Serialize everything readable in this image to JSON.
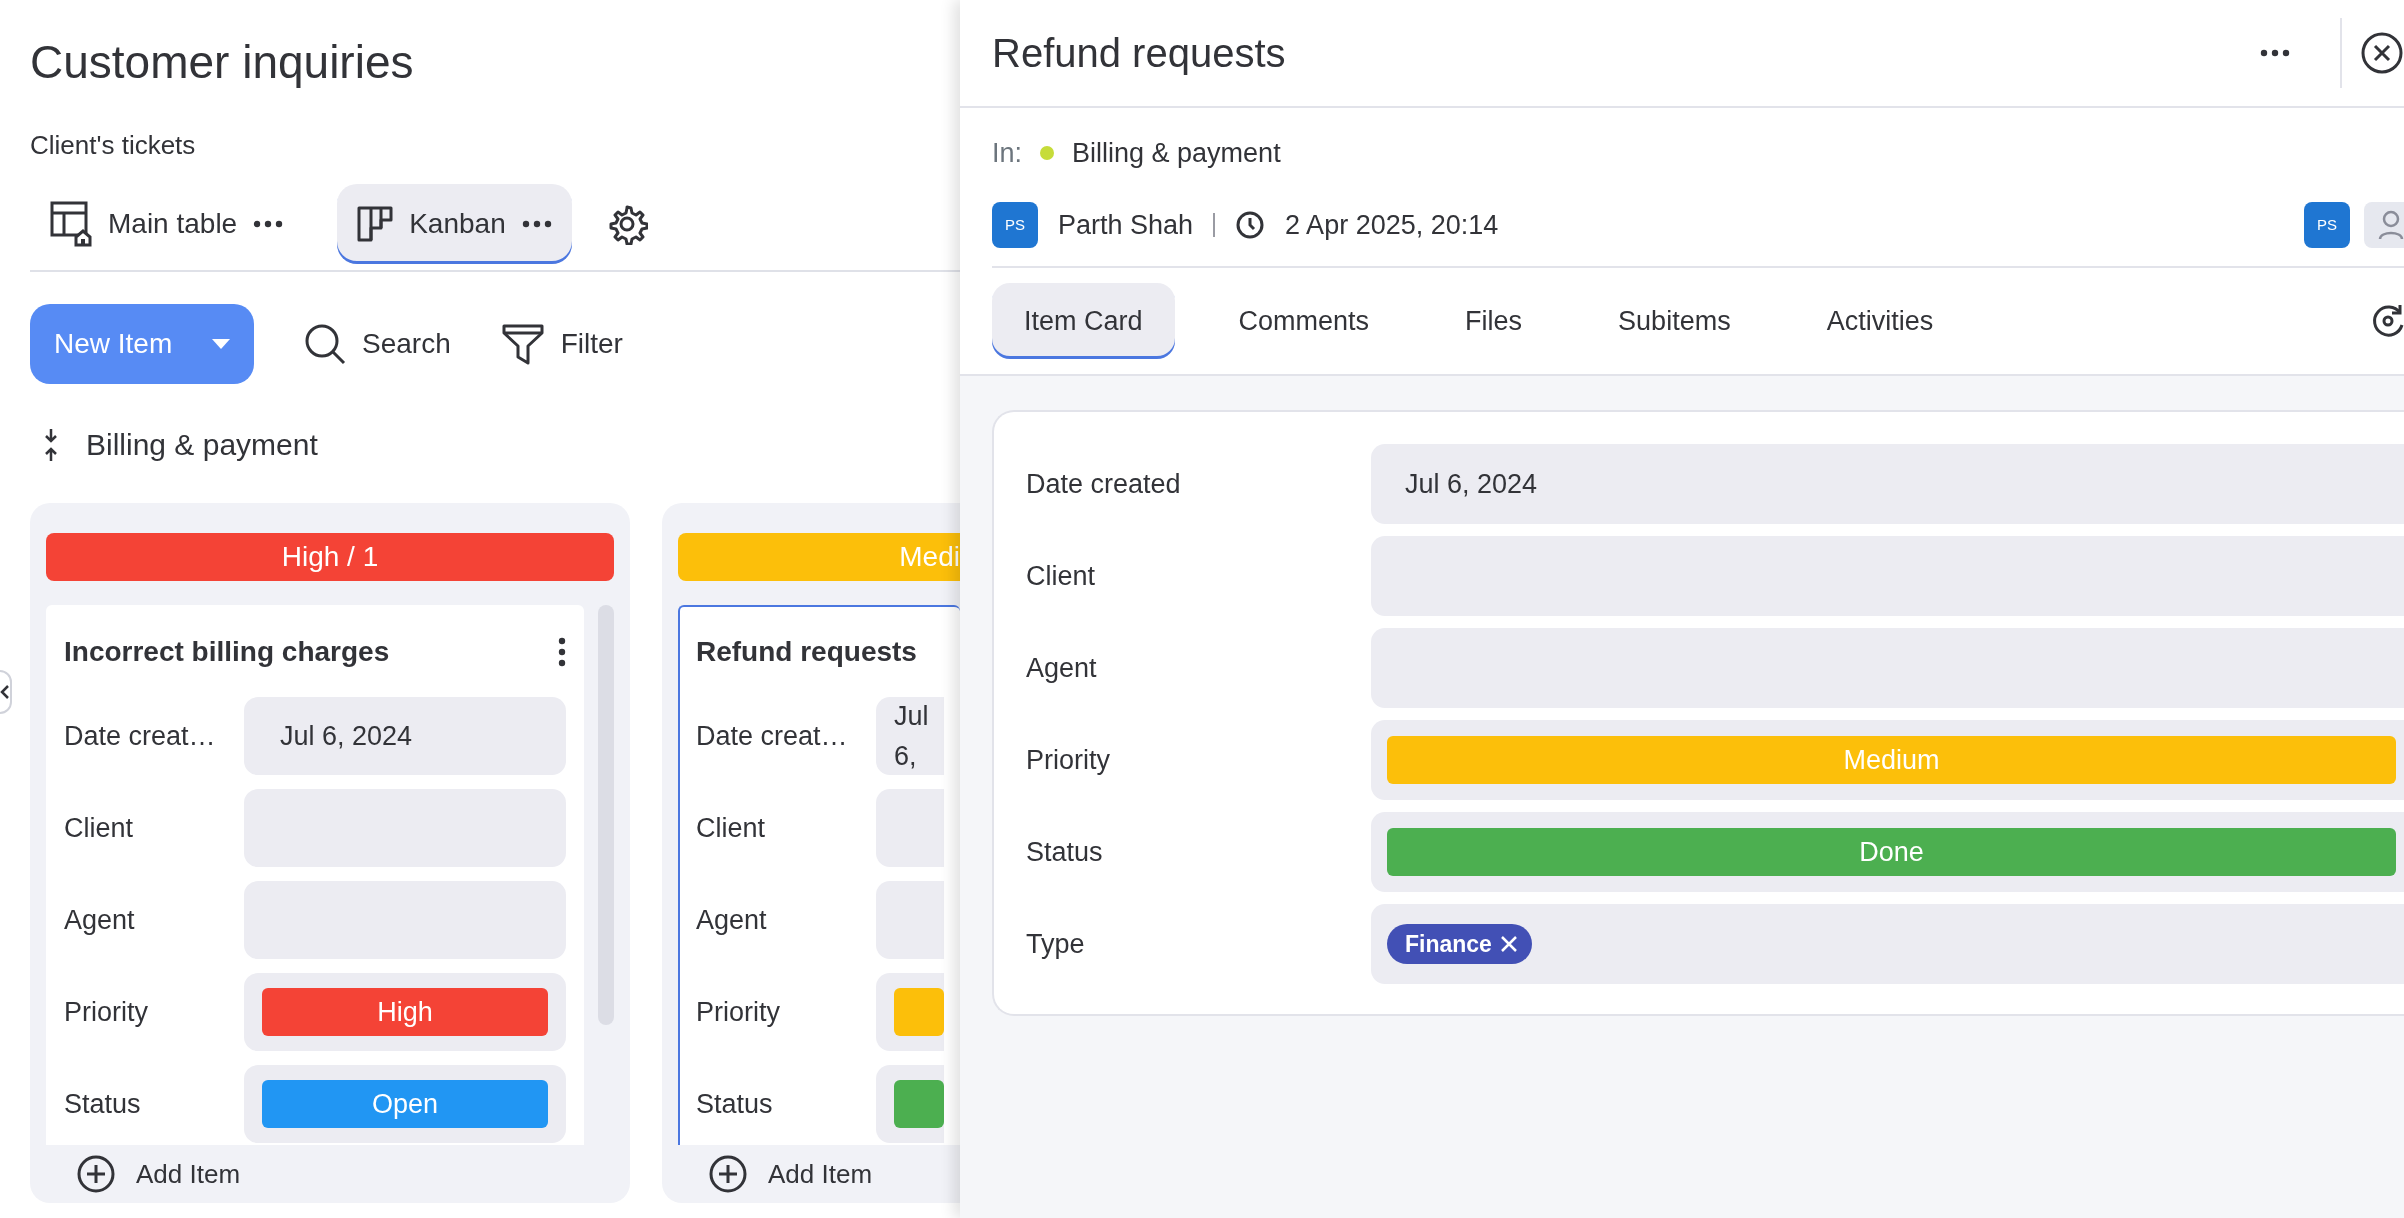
{
  "board": {
    "title": "Customer inquiries",
    "subtitle": "Client's tickets",
    "views": [
      {
        "label": "Main table",
        "kind": "table",
        "selected": false
      },
      {
        "label": "Kanban",
        "kind": "kanban",
        "selected": true
      }
    ],
    "toolbar": {
      "new_item": "New Item",
      "search": "Search",
      "filter": "Filter"
    },
    "group": {
      "title": "Billing & payment"
    },
    "columns": [
      {
        "header": "High / 1",
        "color": "#f44336",
        "add_item": "Add Item",
        "cards": [
          {
            "title": "Incorrect billing charges",
            "selected": false,
            "fields": [
              {
                "label": "Date creat…",
                "kind": "text",
                "value": "Jul 6, 2024"
              },
              {
                "label": "Client",
                "kind": "text"
              },
              {
                "label": "Agent",
                "kind": "text"
              },
              {
                "label": "Priority",
                "kind": "pill",
                "value": "High",
                "color": "#f44336"
              },
              {
                "label": "Status",
                "kind": "pill",
                "value": "Open",
                "color": "#2196f3"
              }
            ]
          }
        ]
      },
      {
        "header": "Medi",
        "color": "#fcbf0a",
        "add_item": "Add Item",
        "cards": [
          {
            "title": "Refund requests",
            "selected": true,
            "fields": [
              {
                "label": "Date creat…",
                "kind": "text",
                "value": "Jul 6,"
              },
              {
                "label": "Client",
                "kind": "text"
              },
              {
                "label": "Agent",
                "kind": "text"
              },
              {
                "label": "Priority",
                "kind": "pill",
                "color": "#fcbf0a"
              },
              {
                "label": "Status",
                "kind": "pill",
                "color": "#4caf50"
              }
            ]
          }
        ]
      }
    ]
  },
  "panel": {
    "title": "Refund requests",
    "location": {
      "prefix": "In:",
      "name": "Billing & payment",
      "color": "#c6dc3a"
    },
    "author": {
      "initials": "PS",
      "name": "Parth Shah"
    },
    "created": "2 Apr 2025, 20:14",
    "subscribers": [
      {
        "initials": "PS"
      }
    ],
    "tabs": [
      {
        "label": "Item Card",
        "selected": true
      },
      {
        "label": "Comments",
        "selected": false
      },
      {
        "label": "Files",
        "selected": false
      },
      {
        "label": "Subitems",
        "selected": false
      },
      {
        "label": "Activities",
        "selected": false
      }
    ],
    "fields": [
      {
        "label": "Date created",
        "kind": "text",
        "value": "Jul 6, 2024"
      },
      {
        "label": "Client",
        "kind": "text"
      },
      {
        "label": "Agent",
        "kind": "text"
      },
      {
        "label": "Priority",
        "kind": "pill",
        "value": "Medium",
        "color": "#fcbf0a"
      },
      {
        "label": "Status",
        "kind": "pill",
        "value": "Done",
        "color": "#4caf50"
      },
      {
        "label": "Type",
        "kind": "tags",
        "tags": [
          {
            "label": "Finance",
            "color": "#4250b5"
          }
        ]
      }
    ]
  }
}
